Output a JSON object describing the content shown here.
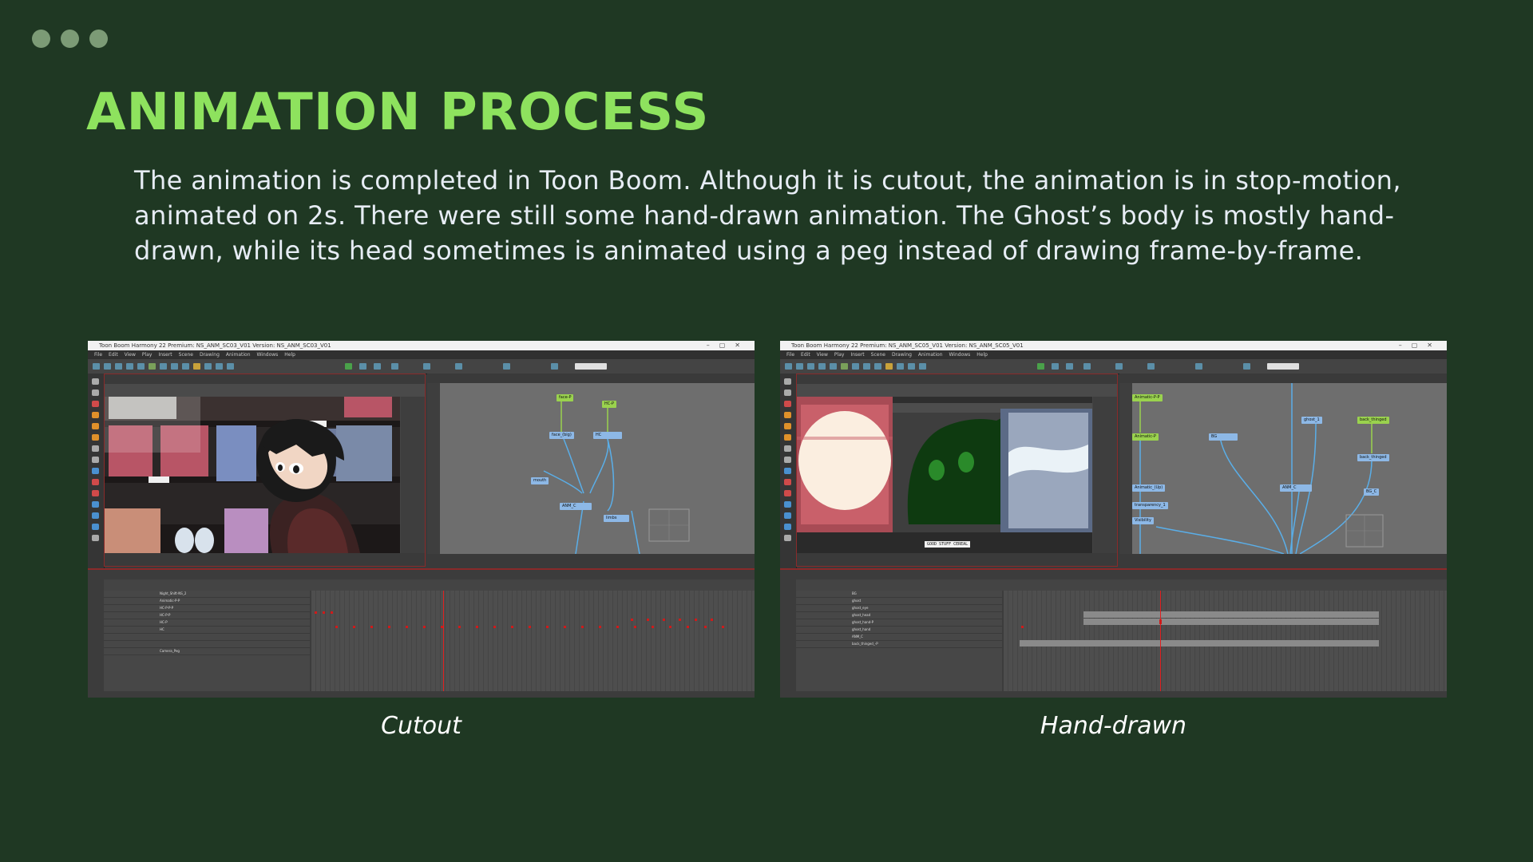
{
  "slide": {
    "title": "ANIMATION PROCESS",
    "body": "The animation is completed in Toon Boom. Although it is cutout, the animation is in stop-motion, animated on 2s. There were still some hand-drawn animation. The Ghost’s body is mostly hand-drawn, while its head sometimes is animated using a peg instead of drawing frame-by-frame."
  },
  "screenshots": [
    {
      "caption": "Cutout",
      "window_title": "Toon Boom Harmony 22 Premium: NS_ANM_SC03_V01 Version: NS_ANM_SC03_V01",
      "menu": [
        "File",
        "Edit",
        "View",
        "Play",
        "Insert",
        "Scene",
        "Drawing",
        "Animation",
        "Windows",
        "Help"
      ],
      "nodes": [
        "face-P",
        "HC-P",
        "face_(big)",
        "HC",
        "mouth",
        "ANM_C",
        "limbs"
      ],
      "layers": [
        "Night_Shift-NS_2",
        "Animatic-P-P",
        "HC-P-P-P",
        "HC-P-P",
        "HC-P",
        "HC",
        "",
        "",
        "Camera_Peg"
      ]
    },
    {
      "caption": "Hand-drawn",
      "window_title": "Toon Boom Harmony 22 Premium: NS_ANM_SC05_V01 Version: NS_ANM_SC05_V01",
      "menu": [
        "File",
        "Edit",
        "View",
        "Play",
        "Insert",
        "Scene",
        "Drawing",
        "Animation",
        "Windows",
        "Help"
      ],
      "nodes": [
        "Animatic-P-P",
        "Animatic-P",
        "BG",
        "ghost_1",
        "back_thinged",
        "back_thinged",
        "BG_C",
        "Animatic_(Up)",
        "transparency_1",
        "Visibility",
        "ANM_C"
      ],
      "cereal_label": "GOOD STUFF CEREAL",
      "layers": [
        "BG",
        "ghost",
        "ghost_eye",
        "ghost_head",
        "ghost_hand-P",
        "ghost_hand",
        "ANM_C",
        "back_thinged_-P"
      ]
    }
  ],
  "colors": {
    "background": "#1f3823",
    "title": "#8ee25e",
    "text": "#e6ecf4",
    "dots": "#7c9b76"
  }
}
